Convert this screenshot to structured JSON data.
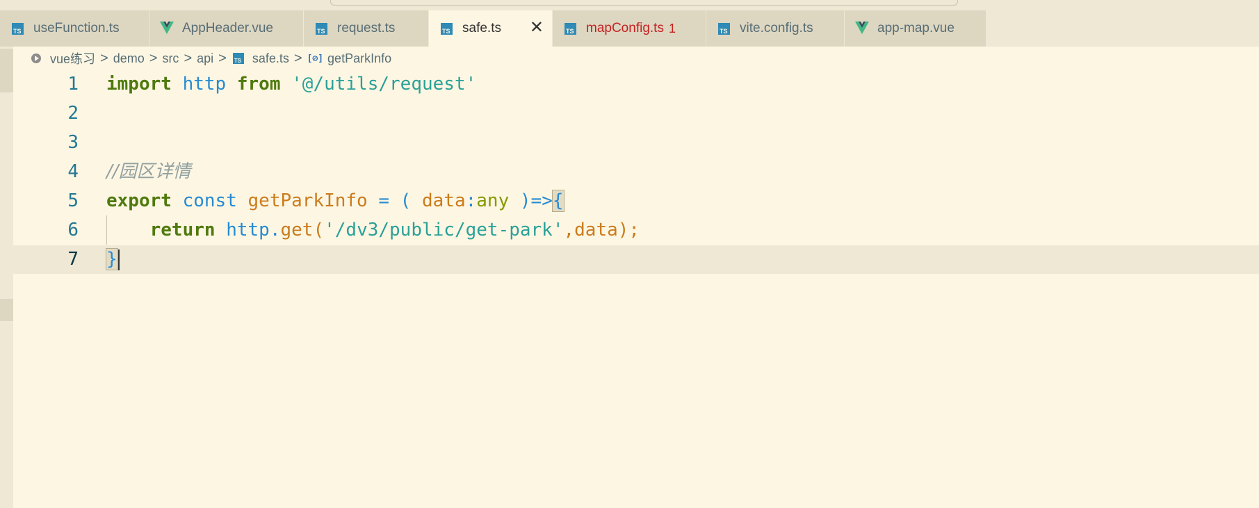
{
  "tabs": [
    {
      "label": "useFunction.ts",
      "icon": "typescript-file-icon",
      "icon_text": "TS",
      "active": false
    },
    {
      "label": "AppHeader.vue",
      "icon": "vue-file-icon",
      "active": false
    },
    {
      "label": "request.ts",
      "icon": "typescript-file-icon",
      "icon_text": "TS",
      "active": false
    },
    {
      "label": "safe.ts",
      "icon": "typescript-file-icon",
      "icon_text": "TS",
      "active": true,
      "close": "✕"
    },
    {
      "label": "mapConfig.ts",
      "icon": "typescript-file-icon",
      "icon_text": "TS",
      "active": false,
      "problems": "1"
    },
    {
      "label": "vite.config.ts",
      "icon": "typescript-file-icon",
      "icon_text": "TS",
      "active": false
    },
    {
      "label": "app-map.vue",
      "icon": "vue-file-icon",
      "active": false
    }
  ],
  "breadcrumb": {
    "items": [
      "vue练习",
      "demo",
      "src",
      "api",
      "safe.ts",
      "getParkInfo"
    ],
    "separator": ">",
    "method_icon_text": "[⊘]"
  },
  "editor": {
    "line_numbers": [
      "1",
      "2",
      "3",
      "4",
      "5",
      "6",
      "7"
    ],
    "code": {
      "l1": {
        "kw_import": "import",
        "var_http": "http",
        "kw_from": "from",
        "str_path": "'@/utils/request'"
      },
      "l4": {
        "comment": "//园区详情"
      },
      "l5": {
        "kw_export": "export",
        "kw_const": "const",
        "fn_name": "getParkInfo",
        "op_eq": "=",
        "paren_open": "(",
        "param": "data",
        "colon": ":",
        "type": "any",
        "paren_close": ")",
        "arrow": "=>",
        "brace_open": "{"
      },
      "l6": {
        "kw_return": "return",
        "obj": "http",
        "dot": ".",
        "method": "get",
        "p_open": "(",
        "str_url": "'/dv3/public/get-park'",
        "comma": ",",
        "arg": "data",
        "p_close": ")",
        "semi": ";"
      },
      "l7": {
        "brace_close": "}"
      }
    }
  },
  "colors": {
    "background": "#fdf6e3",
    "tab_bar": "#eee8d5",
    "keyword": "#4f7a0e",
    "string": "#2aa198",
    "function": "#cb7c1c",
    "error": "#c52222",
    "line_number": "#237893"
  }
}
